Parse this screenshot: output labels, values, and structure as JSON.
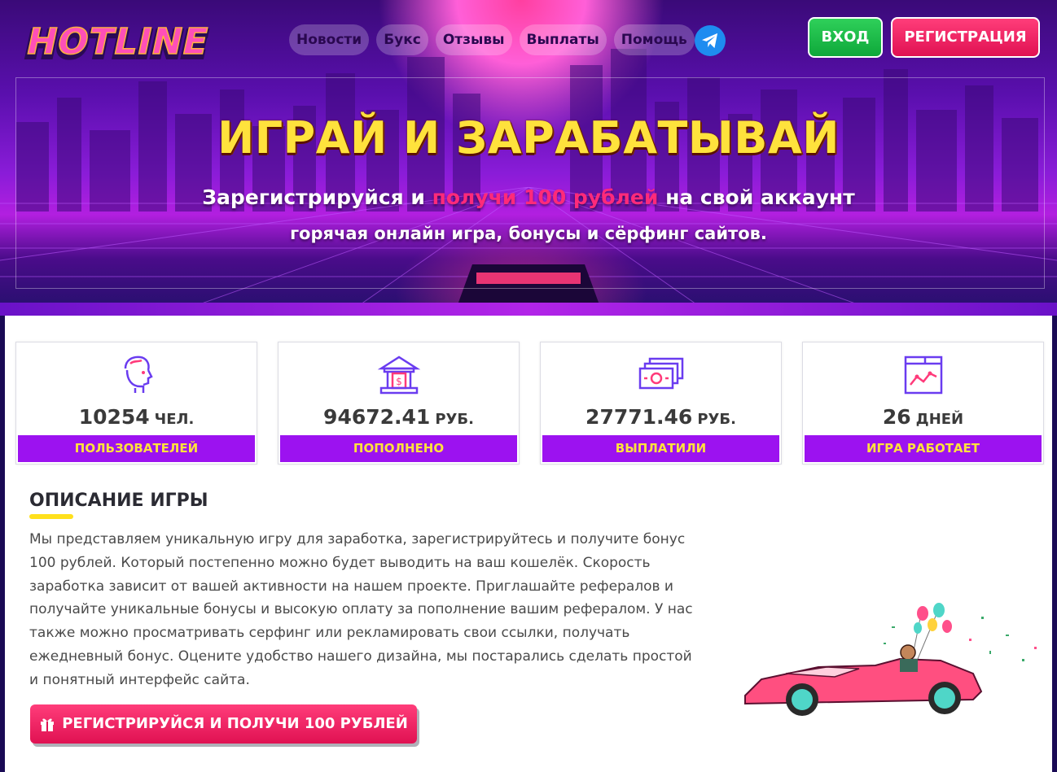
{
  "brand": {
    "logo_text": "HOTLINE"
  },
  "nav": {
    "items": [
      {
        "label": "Новости"
      },
      {
        "label": "Букс"
      },
      {
        "label": "Отзывы"
      },
      {
        "label": "Выплаты"
      },
      {
        "label": "Помощь"
      }
    ],
    "telegram_icon": "telegram-icon"
  },
  "auth": {
    "login_label": "ВХОД",
    "register_label": "РЕГИСТРАЦИЯ"
  },
  "hero": {
    "title": "ИГРАЙ И ЗАРАБАТЫВАЙ",
    "subtitle_prefix": "Зарегистрируйся и ",
    "subtitle_highlight": "получи 100 рублей",
    "subtitle_suffix": " на свой аккаунт",
    "tagline": "горячая онлайн игра, бонусы и сёрфинг сайтов."
  },
  "stats": [
    {
      "icon": "user-head-icon",
      "value": "10254",
      "unit": "ЧЕЛ.",
      "label": "ПОЛЬЗОВАТЕЛЕЙ"
    },
    {
      "icon": "bank-icon",
      "value": "94672.41",
      "unit": "РУБ.",
      "label": "ПОПОЛНЕНО"
    },
    {
      "icon": "banknotes-icon",
      "value": "27771.46",
      "unit": "РУБ.",
      "label": "ВЫПЛАТИЛИ"
    },
    {
      "icon": "chart-window-icon",
      "value": "26",
      "unit": "ДНЕЙ",
      "label": "ИГРА РАБОТАЕТ"
    }
  ],
  "description": {
    "title": "ОПИСАНИЕ ИГРЫ",
    "text": "Мы представляем уникальную игру для заработка, зарегистрируйтесь и получите бонус 100 рублей. Который постепенно можно будет выводить на ваш кошелёк. Скорость заработка зависит от вашей активности на нашем проекте. Приглашайте рефералов и получайте уникальные бонусы и высокую оплату за пополнение вашим рефералом. У нас также можно просматривать серфинг или рекламировать свои ссылки, получать ежедневный бонус. Оцените удобство нашего дизайна, мы постарались сделать простой и понятный интерфейс сайта.",
    "cta_label": "РЕГИСТРИРУЙСЯ И ПОЛУЧИ 100 РУБЛЕЙ",
    "cta_icon": "gift-icon"
  },
  "colors": {
    "accent_purple": "#9c12f0",
    "accent_yellow": "#ffe23c",
    "accent_pink": "#e01152",
    "accent_green": "#0ea83a"
  }
}
